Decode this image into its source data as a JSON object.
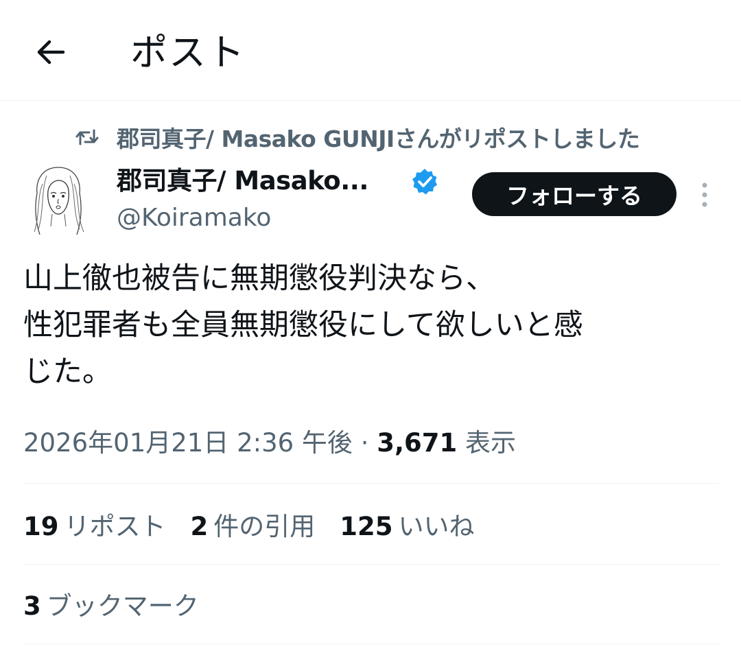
{
  "header": {
    "title": "ポスト",
    "back_icon": "arrow-left-icon"
  },
  "repost": {
    "icon": "repost-icon",
    "text": "郡司真子/ Masako GUNJIさんがリポストしました"
  },
  "author": {
    "display_name": "郡司真子/ Masako...",
    "handle": "@Koiramako",
    "verified_color": "#1d9bf0",
    "follow_label": "フォローする"
  },
  "tweet": {
    "lines": [
      "山上徹也被告に無期懲役判決なら、",
      "性犯罪者も全員無期懲役にして欲しいと感",
      "じた。"
    ]
  },
  "meta": {
    "timestamp": "2026年01月21日 2:36 午後",
    "separator": "·",
    "views_count": "3,671",
    "views_label": "表示"
  },
  "stats": {
    "reposts_count": "19",
    "reposts_label": "リポスト",
    "quotes_count": "2",
    "quotes_label": "件の引用",
    "likes_count": "125",
    "likes_label": "いいね"
  },
  "bookmarks": {
    "count": "3",
    "label": "ブックマーク"
  }
}
